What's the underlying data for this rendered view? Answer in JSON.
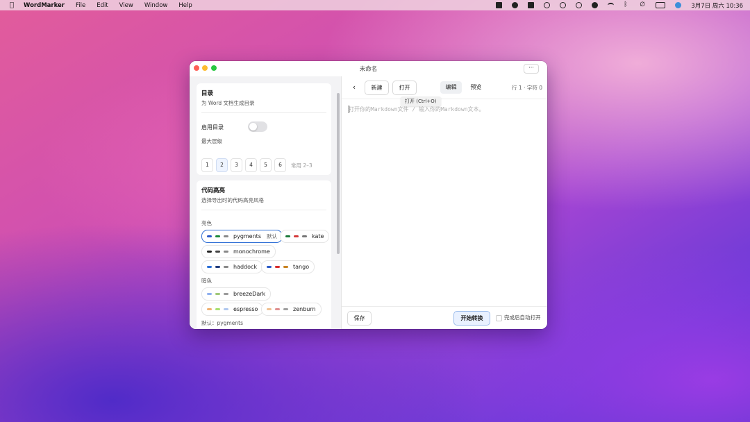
{
  "menubar": {
    "app_name": "WordMarker",
    "menus": [
      "File",
      "Edit",
      "View",
      "Window",
      "Help"
    ],
    "clock": "3月7日 周六  10:36"
  },
  "window": {
    "title": "未命名",
    "more_label": "···"
  },
  "toc": {
    "title": "目录",
    "subtitle": "为 Word 文档生成目录",
    "enable_label": "启用目录",
    "enabled": false,
    "max_level_label": "最大层级",
    "levels": [
      "1",
      "2",
      "3",
      "4",
      "5",
      "6"
    ],
    "selected_level": "2",
    "hint": "常用 2–3"
  },
  "highlight": {
    "title": "代码高亮",
    "subtitle": "选择导出时的代码高亮风格",
    "light_label": "亮色",
    "dark_label": "暗色",
    "default_tag": "默认",
    "footer": "默认：pygments",
    "themes": {
      "pygments": {
        "name": "pygments",
        "colors": [
          "#2a57c7",
          "#1d8b3a",
          "#888888"
        ]
      },
      "kate": {
        "name": "kate",
        "colors": [
          "#1d7a3a",
          "#d43a3a",
          "#777777"
        ]
      },
      "monochrome": {
        "name": "monochrome",
        "colors": [
          "#222222",
          "#444444",
          "#888888"
        ]
      },
      "haddock": {
        "name": "haddock",
        "colors": [
          "#2a6fd6",
          "#1f3a7a",
          "#888888"
        ]
      },
      "tango": {
        "name": "tango",
        "colors": [
          "#2a5bc7",
          "#d62a2a",
          "#c7811f"
        ]
      },
      "breezeDark": {
        "name": "breezeDark",
        "colors": [
          "#8fb0ef",
          "#a0c878",
          "#9a9a9a"
        ]
      },
      "espresso": {
        "name": "espresso",
        "colors": [
          "#f0b070",
          "#a8e070",
          "#b0c8f0"
        ]
      },
      "zenburn": {
        "name": "zenburn",
        "colors": [
          "#f0c090",
          "#e09090",
          "#a0a0a0"
        ]
      }
    }
  },
  "toolbar": {
    "new_label": "新建",
    "open_label": "打开",
    "tooltip": "打开 (Ctrl+O)",
    "tab_edit": "编辑",
    "tab_preview": "预览",
    "counter": "行 1 · 字符 0"
  },
  "editor": {
    "placeholder": "打开你的Markdown文件 / 输入你的Markdown文本。"
  },
  "footer": {
    "save_label": "保存",
    "convert_label": "开始转换",
    "auto_open_label": "完成后自动打开",
    "auto_open_checked": false
  }
}
